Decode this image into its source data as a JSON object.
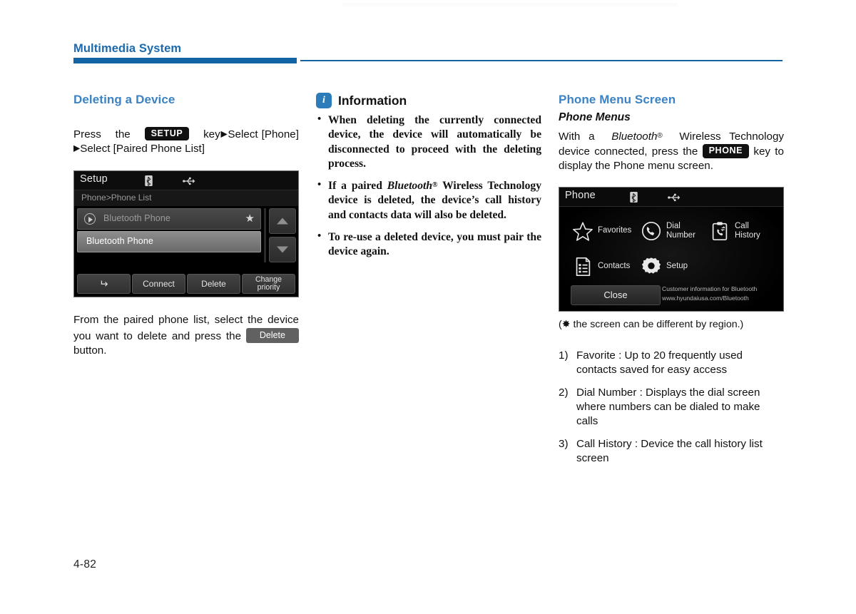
{
  "header": {
    "running_title": "Multimedia System"
  },
  "page_number": "4-82",
  "left_column": {
    "heading": "Deleting a Device",
    "instruction_prefix": "Press",
    "instruction_the": "the",
    "setup_key_label": "SETUP",
    "instruction_key": "key",
    "arrow": "▶",
    "instruction_select1": "Select",
    "instruction_phone": "[Phone]",
    "instruction_select2": "Select [Paired Phone List]",
    "setup_screenshot": {
      "title": "Setup",
      "bluetooth_icon": "bluetooth-icon",
      "usb_icon": "usb-icon",
      "breadcrumb": "Phone>Phone List",
      "rows": [
        {
          "label": "Bluetooth Phone",
          "state": "connected",
          "favorite": true
        },
        {
          "label": "Bluetooth Phone",
          "state": "selected",
          "favorite": false
        }
      ],
      "scroll_up_icon": "triangle-up-icon",
      "scroll_down_icon": "triangle-down-icon",
      "buttons": [
        {
          "label": "",
          "icon": "back-arrow-icon"
        },
        {
          "label": "Connect",
          "icon": ""
        },
        {
          "label": "Delete",
          "icon": ""
        },
        {
          "label": "Change\npriority",
          "line1": "Change",
          "line2": "priority",
          "icon": ""
        }
      ]
    },
    "caption_line1": "From the paired phone list, select the device you want to delete and press the",
    "delete_button_label": "Delete",
    "caption_line2": "button."
  },
  "middle_column": {
    "info_icon": "information-icon",
    "info_title": "Information",
    "bullets": [
      "When deleting the currently connected device, the device will automatically be disconnected to proceed with the deleting process.",
      "If a paired Bluetooth® Wireless Technology device is deleted, the device's call history and contacts data will also be deleted.",
      "To re-use a deleted device, you must pair the device again."
    ],
    "bullet2_parts": {
      "pre": "If a paired ",
      "italic": "Bluetooth",
      "reg": "®",
      "post": " Wireless Technology device is deleted, the device’s call history and contacts data will also be deleted."
    }
  },
  "right_column": {
    "heading": "Phone Menu Screen",
    "subheading": "Phone Menus",
    "paragraph_pre": "With a",
    "paragraph_bt": "Bluetooth",
    "paragraph_reg": "®",
    "paragraph_mid": "Wireless Technology device connected, press the",
    "phone_key_label": "PHONE",
    "paragraph_post": "key to display the Phone menu screen.",
    "phone_screenshot": {
      "title": "Phone",
      "bluetooth_icon": "bluetooth-icon",
      "usb_icon": "usb-icon",
      "menu_items": [
        {
          "label": "Favorites",
          "icon": "star-icon",
          "lines": [
            "Favorites"
          ]
        },
        {
          "label": "Dial Number",
          "icon": "handset-icon",
          "lines": [
            "Dial",
            "Number"
          ]
        },
        {
          "label": "Call History",
          "icon": "call-history-icon",
          "lines": [
            "Call",
            "History"
          ]
        },
        {
          "label": "Contacts",
          "icon": "contacts-icon",
          "lines": [
            "Contacts"
          ]
        },
        {
          "label": "Setup",
          "icon": "gear-icon",
          "lines": [
            "Setup"
          ]
        }
      ],
      "close_label": "Close",
      "customer_info_line1": "Customer information for Bluetooth",
      "customer_info_line2": "www.hyundaiusa.com/Bluetooth"
    },
    "region_note": "(✸ the screen can be different by region.)",
    "numbered_items": [
      {
        "num": "1)",
        "text": "Favorite : Up to 20 frequently used contacts saved for easy access"
      },
      {
        "num": "2)",
        "text": "Dial Number : Displays the dial screen where numbers can be dialed to make calls"
      },
      {
        "num": "3)",
        "text": "Call History : Device the call history list screen"
      }
    ]
  },
  "colors": {
    "accent_blue": "#1263a4",
    "heading_blue": "#3b83c4",
    "info_icon_blue": "#2b7cb8"
  }
}
